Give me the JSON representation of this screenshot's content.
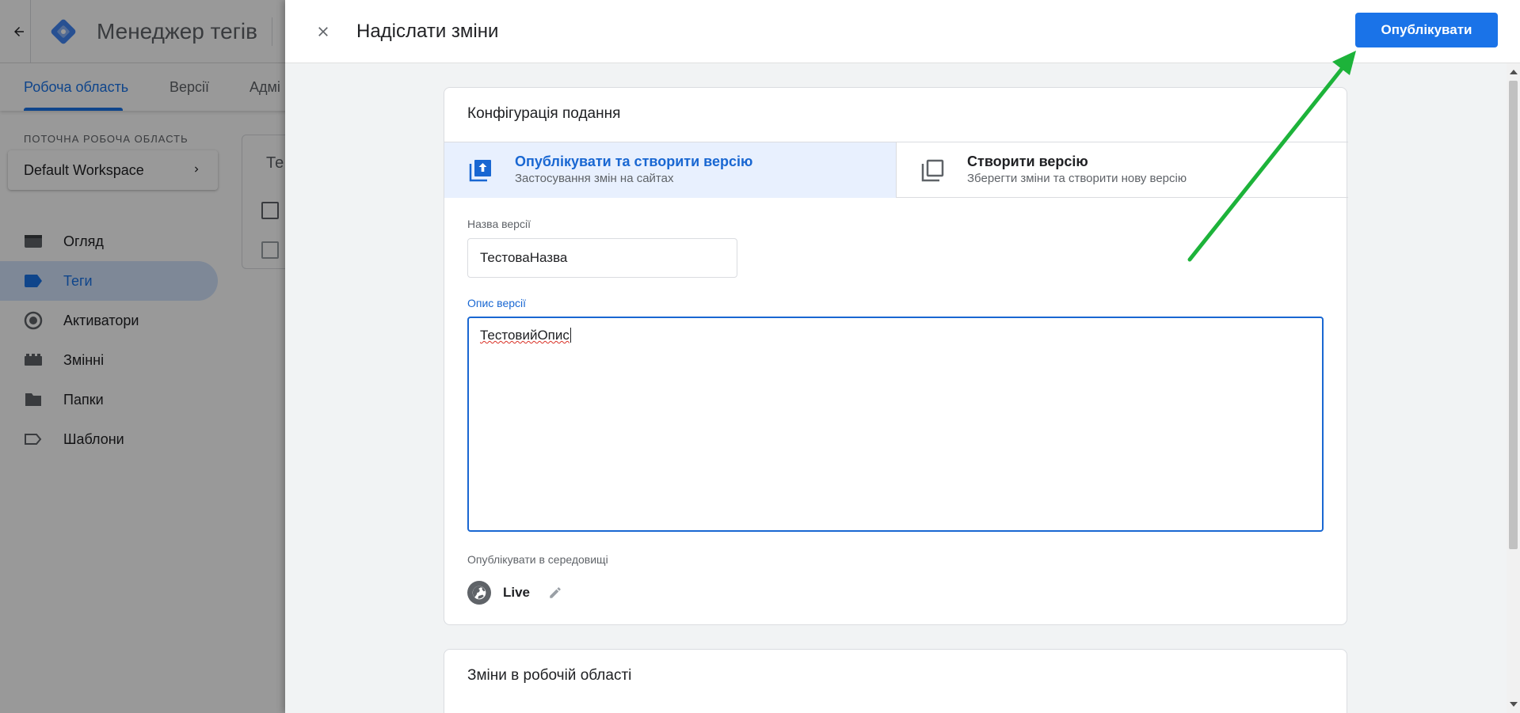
{
  "app": {
    "title": "Менеджер тегів",
    "tabs": [
      {
        "label": "Робоча область",
        "active": true
      },
      {
        "label": "Версії",
        "active": false
      },
      {
        "label": "Адмі",
        "active": false
      }
    ],
    "workspace_label": "ПОТОЧНА РОБОЧА ОБЛАСТЬ",
    "workspace_name": "Default Workspace",
    "nav": [
      {
        "label": "Огляд",
        "icon": "overview-icon",
        "active": false
      },
      {
        "label": "Теги",
        "icon": "tag-icon",
        "active": true
      },
      {
        "label": "Активатори",
        "icon": "trigger-icon",
        "active": false
      },
      {
        "label": "Змінні",
        "icon": "variables-icon",
        "active": false
      },
      {
        "label": "Папки",
        "icon": "folder-icon",
        "active": false
      },
      {
        "label": "Шаблони",
        "icon": "template-icon",
        "active": false
      }
    ],
    "bg_card_text": "Те"
  },
  "panel": {
    "title": "Надіслати зміни",
    "publish_label": "Опублікувати",
    "config_title": "Конфігурація подання",
    "options": [
      {
        "title": "Опублікувати та створити версію",
        "subtitle": "Застосування змін на сайтах",
        "selected": true
      },
      {
        "title": "Створити версію",
        "subtitle": "Зберегти зміни та створити нову версію",
        "selected": false
      }
    ],
    "version_name_label": "Назва версії",
    "version_name_value": "ТестоваНазва",
    "version_desc_label": "Опис версії",
    "version_desc_value": "ТестовийОпис",
    "env_label": "Опублікувати в середовищі",
    "env_name": "Live",
    "changes_title": "Зміни в робочій області"
  },
  "colors": {
    "accent": "#1a73e8",
    "arrow": "#1db33a"
  }
}
